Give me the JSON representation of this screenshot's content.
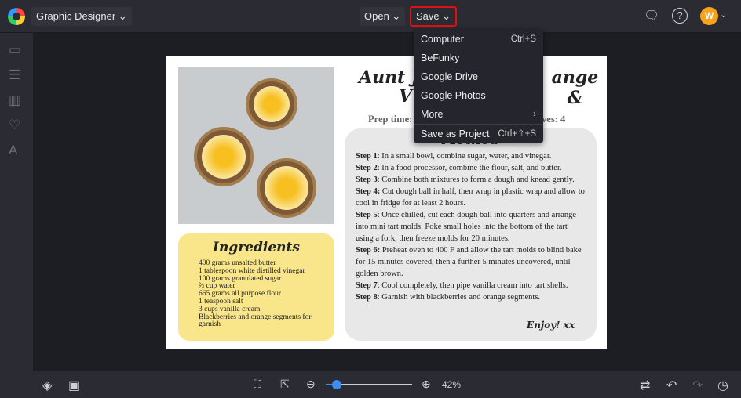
{
  "header": {
    "mode_label": "Graphic Designer",
    "open_label": "Open",
    "save_label": "Save",
    "avatar_initial": "W"
  },
  "save_menu": [
    {
      "label": "Computer",
      "shortcut": "Ctrl+S"
    },
    {
      "label": "BeFunky",
      "shortcut": ""
    },
    {
      "label": "Google Drive",
      "shortcut": ""
    },
    {
      "label": "Google Photos",
      "shortcut": ""
    },
    {
      "label": "More",
      "shortcut": "›"
    },
    {
      "label": "Save as Project",
      "shortcut": "Ctrl+⇧+S"
    }
  ],
  "recipe": {
    "title_left": "Aunt Ju",
    "title_right": "ange &",
    "title_line2": "V",
    "prep": "Prep time:",
    "serves": "Serves: 4",
    "ingredients_title": "Ingredients",
    "ingredients": [
      "400 grams unsalted butter",
      "1 tablespoon white distilled vinegar",
      "100 grams granulated sugar",
      "⅔ cup water",
      "665 grams all purpose flour",
      "1 teaspoon salt",
      "3 cups vanilla cream",
      "Blackberries and orange segments for garnish"
    ],
    "method_title": "Method",
    "steps": [
      {
        "n": "Step 1",
        "t": ": In a small bowl, combine sugar, water, and vinegar."
      },
      {
        "n": "Step 2",
        "t": ": In a food processor, combine the flour, salt, and butter."
      },
      {
        "n": "Step 3",
        "t": ": Combine both mixtures to form a dough and knead gently."
      },
      {
        "n": "Step 4:",
        "t": " Cut dough ball in half, then wrap in plastic wrap and allow to cool in fridge for at least 2 hours."
      },
      {
        "n": "Step 5",
        "t": ": Once chilled, cut each dough ball into quarters and arrange into mini tart molds. Poke small holes into the bottom of the tart using a fork, then freeze molds for 20 minutes."
      },
      {
        "n": "Step 6:",
        "t": " Preheat oven to 400 F and allow the tart molds to blind bake for 15 minutes covered, then a further 5 minutes uncovered, until golden brown."
      },
      {
        "n": "Step 7",
        "t": ": Cool completely, then pipe vanilla cream into tart shells."
      },
      {
        "n": "Step 8",
        "t": ": Garnish with blackberries and orange segments."
      }
    ],
    "signoff": "Enjoy! xx"
  },
  "footer": {
    "zoom_label": "42%",
    "zoom_value": 42
  }
}
